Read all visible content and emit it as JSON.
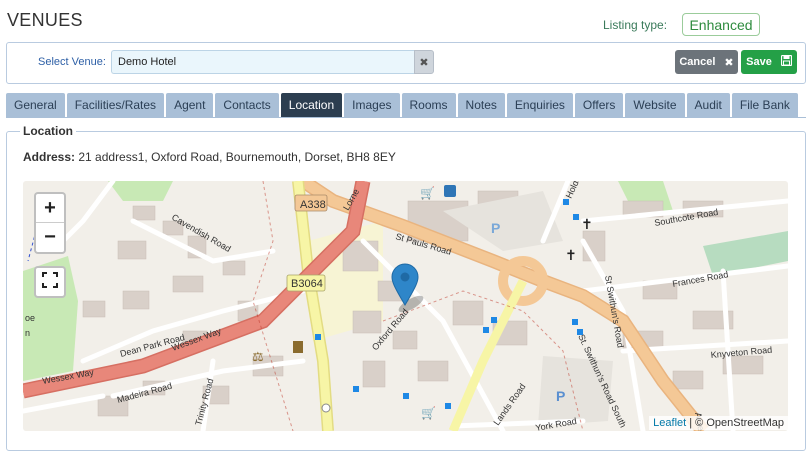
{
  "header": {
    "title": "VENUES",
    "listing_type_label": "Listing type:",
    "listing_type_value": "Enhanced"
  },
  "venue_bar": {
    "label": "Select Venue:",
    "value": "Demo Hotel",
    "cancel_label": "Cancel",
    "save_label": "Save"
  },
  "tabs": [
    {
      "label": "General",
      "active": false
    },
    {
      "label": "Facilities/Rates",
      "active": false
    },
    {
      "label": "Agent",
      "active": false
    },
    {
      "label": "Contacts",
      "active": false
    },
    {
      "label": "Location",
      "active": true
    },
    {
      "label": "Images",
      "active": false
    },
    {
      "label": "Rooms",
      "active": false
    },
    {
      "label": "Notes",
      "active": false
    },
    {
      "label": "Enquiries",
      "active": false
    },
    {
      "label": "Offers",
      "active": false
    },
    {
      "label": "Website",
      "active": false
    },
    {
      "label": "Audit",
      "active": false
    },
    {
      "label": "File Bank",
      "active": false
    }
  ],
  "location": {
    "legend": "Location",
    "address_label": "Address:",
    "address_value": "21 address1, Oxford Road, Bournemouth, Dorset, BH8 8EY"
  },
  "map": {
    "zoom_in": "+",
    "zoom_out": "−",
    "attribution_link": "Leaflet",
    "attribution_text": "| © OpenStreetMap",
    "labels": {
      "a338": "A338",
      "b3064": "B3064",
      "st_pauls_road": "St Pauls Road",
      "wessex_way": "Wessex Way",
      "wessex_way_2": "Wessex Way",
      "dean_park_road": "Dean Park Road",
      "cavendish_road": "Cavendish Road",
      "oxford_road": "Oxford Road",
      "madeira_road": "Madeira Road",
      "southcote_road": "Southcote Road",
      "frances_road": "Frances Road",
      "knyveton_road": "Knyveton Road",
      "st_swithuns_road": "St Swithun's Road",
      "st_swithuns_road_south": "St. Swithun's Road South",
      "york_road": "York Road",
      "trinity_road": "Trinity Road",
      "lands_road": "Lands Road",
      "holdenhurst": "Holde",
      "lorne_park": "Lorne",
      "poole": "oe",
      "poole2": "n",
      "ame": "Ame"
    },
    "colors": {
      "main_road": "#f4c896",
      "primary_road": "#e8877a",
      "secondary_road": "#f7f5a6",
      "park": "#c8e9b5",
      "building": "#d9d0c9",
      "marker": "#2e86c9"
    }
  }
}
